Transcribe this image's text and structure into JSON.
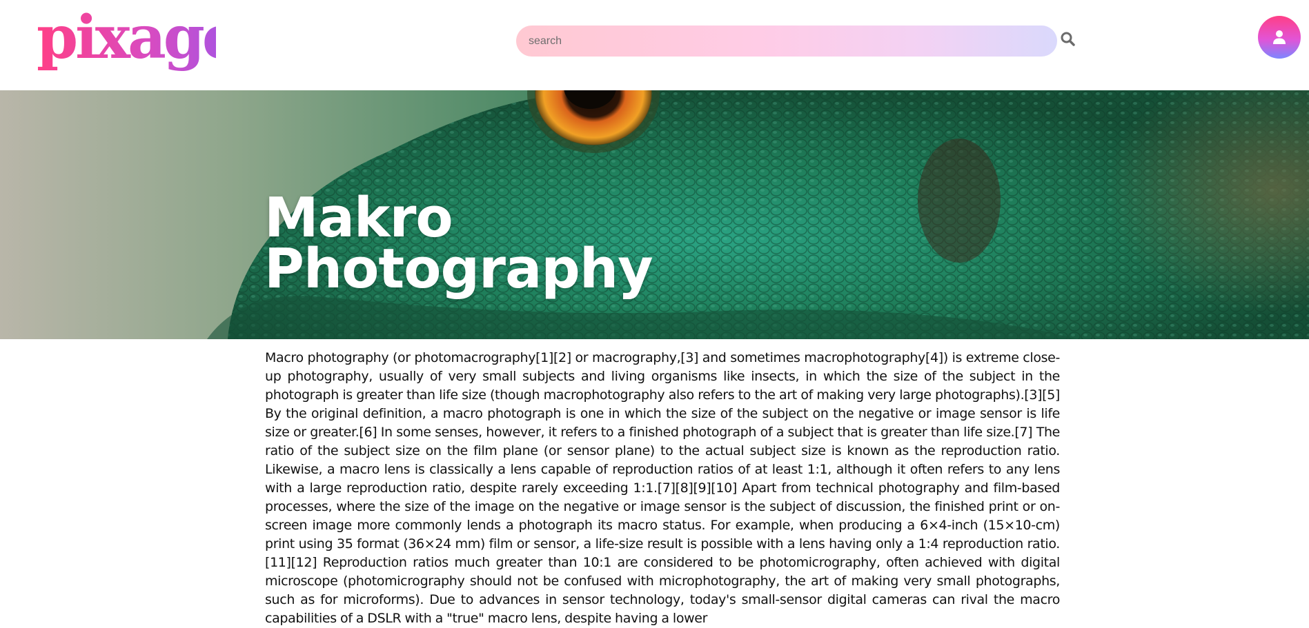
{
  "header": {
    "logo_text": "pixage",
    "search": {
      "placeholder": "search",
      "value": ""
    },
    "search_icon": "search-icon",
    "profile_icon": "user-icon"
  },
  "hero": {
    "title_line1": "Makro",
    "title_line2": "Photography"
  },
  "article": {
    "text": "Macro photography (or photomacrography[1][2] or macrography,[3] and sometimes macrophotography[4]) is extreme close-up photography, usually of very small subjects and living organisms like insects, in which the size of the subject in the photograph is greater than life size (though macrophotography also refers to the art of making very large photographs).[3][5] By the original definition, a macro photograph is one in which the size of the subject on the negative or image sensor is life size or greater.[6] In some senses, however, it refers to a finished photograph of a subject that is greater than life size.[7] The ratio of the subject size on the film plane (or sensor plane) to the actual subject size is known as the reproduction ratio. Likewise, a macro lens is classically a lens capable of reproduction ratios of at least 1:1, although it often refers to any lens with a large reproduction ratio, despite rarely exceeding 1:1.[7][8][9][10] Apart from technical photography and film-based processes, where the size of the image on the negative or image sensor is the subject of discussion, the finished print or on-screen image more commonly lends a photograph its macro status. For example, when producing a 6×4-inch (15×10-cm) print using 35 format (36×24 mm) film or sensor, a life-size result is possible with a lens having only a 1:4 reproduction ratio.[11][12] Reproduction ratios much greater than 10:1 are considered to be photomicrography, often achieved with digital microscope (photomicrography should not be confused with microphotography, the art of making very small photographs, such as for microforms). Due to advances in sensor technology, today's small-sensor digital cameras can rival the macro capabilities of a DSLR with a \"true\" macro lens, despite having a lower"
  },
  "colors": {
    "brand_pink": "#ff3f86",
    "brand_purple": "#c04bd8",
    "search_gradient_start": "#ffc9d2",
    "search_gradient_end": "#dad9fc",
    "hero_title": "#ffffff"
  }
}
